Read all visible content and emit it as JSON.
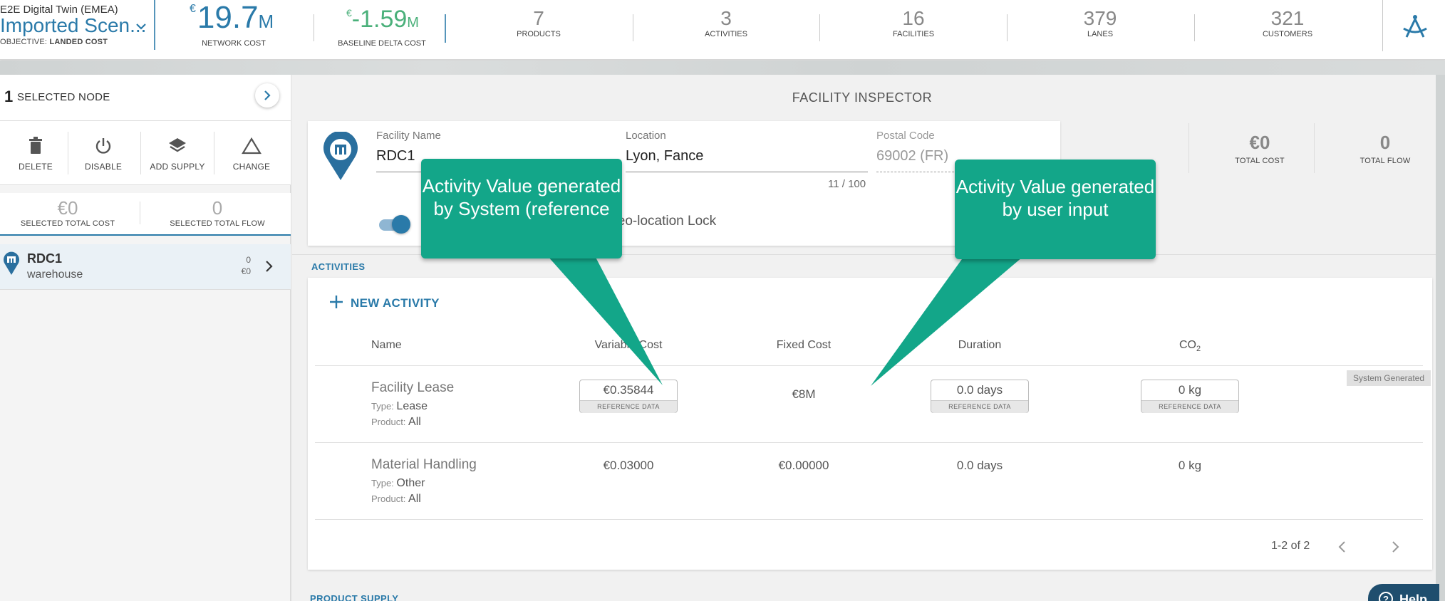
{
  "header": {
    "twin_name": "E2E Digital Twin (EMEA)",
    "scenario_title": "Imported Scen...",
    "objective_prefix": "OBJECTIVE:",
    "objective_value": "LANDED COST",
    "network_cost": {
      "currency": "€",
      "value": "19.7",
      "unit": "M",
      "label": "NETWORK COST"
    },
    "baseline_delta": {
      "currency": "€",
      "value": "-1.59",
      "unit": "M",
      "label": "BASELINE DELTA COST"
    },
    "stats": [
      {
        "value": "7",
        "label": "PRODUCTS"
      },
      {
        "value": "3",
        "label": "ACTIVITIES"
      },
      {
        "value": "16",
        "label": "FACILITIES"
      },
      {
        "value": "379",
        "label": "LANES"
      },
      {
        "value": "321",
        "label": "CUSTOMERS"
      }
    ],
    "logo_icon": "compass-icon"
  },
  "left_panel": {
    "selected_count": "1",
    "selected_label": "SELECTED NODE",
    "actions": [
      {
        "label": "DELETE",
        "icon": "trash-icon"
      },
      {
        "label": "DISABLE",
        "icon": "power-icon"
      },
      {
        "label": "ADD SUPPLY",
        "icon": "layers-icon"
      },
      {
        "label": "CHANGE",
        "icon": "triangle-icon"
      }
    ],
    "selected_total_cost": "€0",
    "selected_total_cost_label": "SELECTED TOTAL COST",
    "selected_total_flow": "0",
    "selected_total_flow_label": "SELECTED TOTAL FLOW",
    "node": {
      "name": "RDC1",
      "type": "warehouse",
      "flow": "0",
      "cost": "€0"
    }
  },
  "inspector": {
    "title": "FACILITY INSPECTOR",
    "facility_name_label": "Facility Name",
    "facility_name_value": "RDC1",
    "name_counter": "11 / 100",
    "location_label": "Location",
    "location_value": "Lyon, Fance",
    "postal_label": "Postal Code",
    "postal_value": "69002 (FR)",
    "geo_lock_label": "Geo-location Lock",
    "total_cost": "€0",
    "total_cost_label": "TOTAL COST",
    "total_flow": "0",
    "total_flow_label": "TOTAL FLOW"
  },
  "activities": {
    "section_title": "ACTIVITIES",
    "new_activity_label": "NEW ACTIVITY",
    "columns": {
      "name": "Name",
      "variable_cost": "Variable Cost",
      "fixed_cost": "Fixed Cost",
      "duration": "Duration",
      "co2": "CO",
      "co2_sub": "2"
    },
    "system_generated_badge": "System Generated",
    "type_prefix": "Type:",
    "product_prefix": "Product:",
    "reference_tag": "REFERENCE DATA",
    "rows": [
      {
        "name": "Facility Lease",
        "type": "Lease",
        "product": "All",
        "variable_cost": "€0.35844",
        "fixed_cost": "€8M",
        "duration": "0.0 days",
        "co2": "0 kg"
      },
      {
        "name": "Material Handling",
        "type": "Other",
        "product": "All",
        "variable_cost": "€0.03000",
        "fixed_cost": "€0.00000",
        "duration": "0.0 days",
        "co2": "0 kg"
      }
    ],
    "pagination": "1-2 of 2"
  },
  "product_supply_title": "PRODUCT SUPPLY",
  "callouts": {
    "left": "Activity Value generated by System (reference",
    "right": "Activity Value generated by user input"
  },
  "help_label": "Help",
  "colors": {
    "accent": "#2a7aa9",
    "delta_green": "#4ab07a",
    "callout": "#13a689"
  }
}
